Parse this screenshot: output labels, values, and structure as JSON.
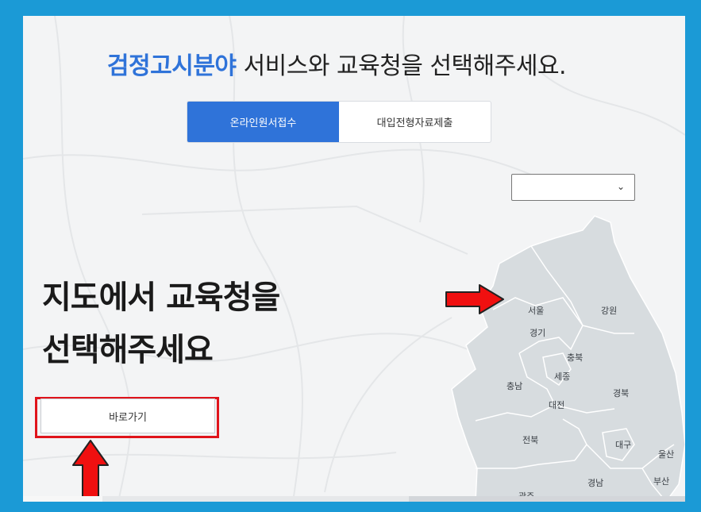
{
  "header": {
    "accent": "검정고시분야",
    "rest": " 서비스와 교육청을 선택해주세요."
  },
  "tabs": [
    {
      "label": "온라인원서접수",
      "active": true
    },
    {
      "label": "대입전형자료제출",
      "active": false
    }
  ],
  "region_select": {
    "value": "",
    "icon": "chevron-down-icon"
  },
  "main": {
    "title_line1": "지도에서 교육청을",
    "title_line2": "선택해주세요",
    "go_button_label": "바로가기"
  },
  "map": {
    "regions": {
      "seoul": "서울",
      "gangwon": "강원",
      "gyeonggi": "경기",
      "chungbuk": "충북",
      "chungnam": "충남",
      "sejong": "세종",
      "daejeon": "대전",
      "gyeongbuk": "경북",
      "jeonbuk": "전북",
      "daegu": "대구",
      "ulsan": "울산",
      "gyeongnam": "경남",
      "busan": "부산",
      "gwangju": "광주"
    }
  },
  "colors": {
    "accent_blue": "#2f73d9",
    "outer_frame": "#1b9ad6",
    "highlight_red": "#e0141b",
    "map_fill": "#d7dcdf"
  }
}
